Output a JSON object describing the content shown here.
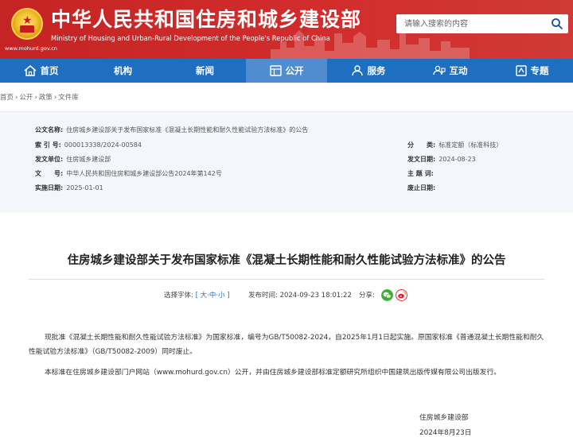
{
  "header": {
    "title": "中华人民共和国住房和城乡建设部",
    "subtitle": "Ministry of Housing and Urban-Rural Development of the People's Republic of China",
    "url": "www.mohurd.gov.cn",
    "search_placeholder": "请输入搜索的内容"
  },
  "nav": {
    "items": [
      {
        "label": "首页",
        "icon": "home-icon"
      },
      {
        "label": "机构"
      },
      {
        "label": "新闻"
      },
      {
        "label": "公开",
        "icon": "open-icon",
        "active": true
      },
      {
        "label": "服务",
        "icon": "service-icon"
      },
      {
        "label": "互动",
        "icon": "interact-icon"
      },
      {
        "label": "专题",
        "icon": "topic-icon"
      }
    ]
  },
  "breadcrumb": [
    "首页",
    "公开",
    "政策",
    "文件库"
  ],
  "breadcrumb_sep": "›",
  "info": {
    "name_label": "公文名称:",
    "name_value": "住房城乡建设部关于发布国家标准《混凝土长期性能和耐久性能试验方法标准》的公告",
    "index_label": "索 引 号:",
    "index_value": "000013338/2024-00584",
    "category_label": "分　　类:",
    "category_value": "标准定额（标准科技）",
    "issuer_label": "发文单位:",
    "issuer_value": "住房城乡建设部",
    "date_label": "发文日期:",
    "date_value": "2024-08-23",
    "docno_label": "文　　号:",
    "docno_value": "中华人民共和国住房和城乡建设部公告2024年第142号",
    "subject_label": "主 题 词:",
    "subject_value": "",
    "effective_label": "实施日期:",
    "effective_value": "2025-01-01",
    "repeal_label": "废止日期:",
    "repeal_value": ""
  },
  "article": {
    "title": "住房城乡建设部关于发布国家标准《混凝土长期性能和耐久性能试验方法标准》的公告",
    "font_label": "选择字体:",
    "font_open": "[",
    "font_large": "大",
    "font_dot1": "·",
    "font_medium": "中",
    "font_dot2": "·",
    "font_small": "小",
    "font_close": "]",
    "publish_label": "发布时间:",
    "publish_time": "2024-09-23 18:01:22",
    "share_label": "分享:",
    "para1": "现批准《混凝土长期性能和耐久性能试验方法标准》为国家标准，编号为GB/T50082-2024，自2025年1月1日起实施。原国家标准《普通混凝土长期性能和耐久性能试验方法标准》（GB/T50082-2009）同时废止。",
    "para2": "本标准在住房城乡建设部门户网站（www.mohurd.gov.cn）公开，并由住房城乡建设部标准定额研究所组织中国建筑出版传媒有限公司出版发行。",
    "sign_org": "住房城乡建设部",
    "sign_date": "2024年8月23日"
  },
  "colors": {
    "header_red": "#c52424",
    "nav_blue": "#1f6fc0",
    "nav_active": "#4f8dd0",
    "info_bg": "#f3f6fb",
    "wechat_green": "#3cb034",
    "weibo_red": "#e6162d"
  }
}
